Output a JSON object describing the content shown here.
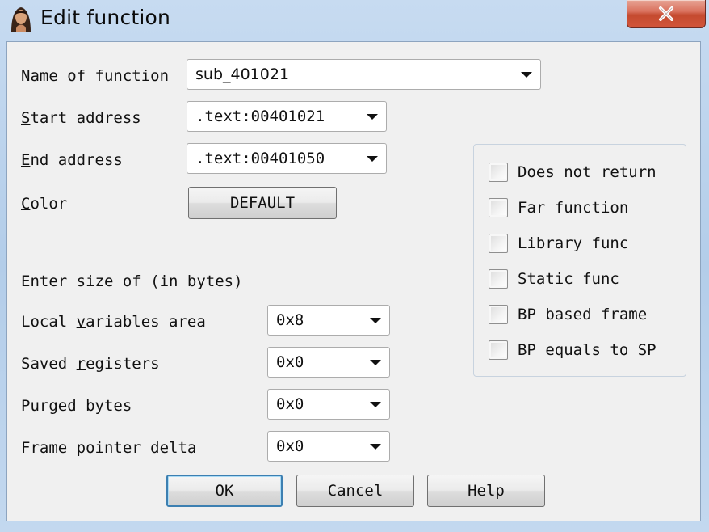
{
  "window": {
    "title": "Edit function",
    "close_symbol": "×"
  },
  "fields": {
    "name_label_accel": "N",
    "name_label_rest": "ame of function",
    "name_value": "sub_401021",
    "start_label_accel": "S",
    "start_label_rest": "tart address",
    "start_value": ".text:00401021",
    "end_label_accel": "E",
    "end_label_rest": "nd address",
    "end_value": ".text:00401050",
    "color_label_accel": "C",
    "color_label_rest": "olor",
    "color_button": "DEFAULT"
  },
  "size_section": {
    "heading": "Enter size of (in bytes)",
    "local_vars_pre": "Local ",
    "local_vars_accel": "v",
    "local_vars_post": "ariables area",
    "local_vars_value": "0x8",
    "saved_regs_pre": "Saved ",
    "saved_regs_accel": "r",
    "saved_regs_post": "egisters",
    "saved_regs_value": "0x0",
    "purged_accel": "P",
    "purged_post": "urged bytes",
    "purged_value": "0x0",
    "fp_delta_pre": "Frame pointer ",
    "fp_delta_accel": "d",
    "fp_delta_post": "elta",
    "fp_delta_value": "0x0"
  },
  "flags": [
    {
      "label": "Does not return",
      "checked": false
    },
    {
      "label": "Far function",
      "checked": false
    },
    {
      "label": "Library func",
      "checked": false
    },
    {
      "label": "Static func",
      "checked": false
    },
    {
      "label": "BP based frame",
      "checked": false
    },
    {
      "label": "BP equals to SP",
      "checked": false
    }
  ],
  "buttons": {
    "ok": "OK",
    "cancel": "Cancel",
    "help": "Help"
  },
  "icons": {
    "app": "ida-portrait-icon",
    "close": "close-icon",
    "dropdown": "chevron-down-icon"
  },
  "colors": {
    "close_button": "#c44a2f",
    "default_button_border": "#3c7fb1",
    "dialog_background": "#f0f0f0"
  }
}
